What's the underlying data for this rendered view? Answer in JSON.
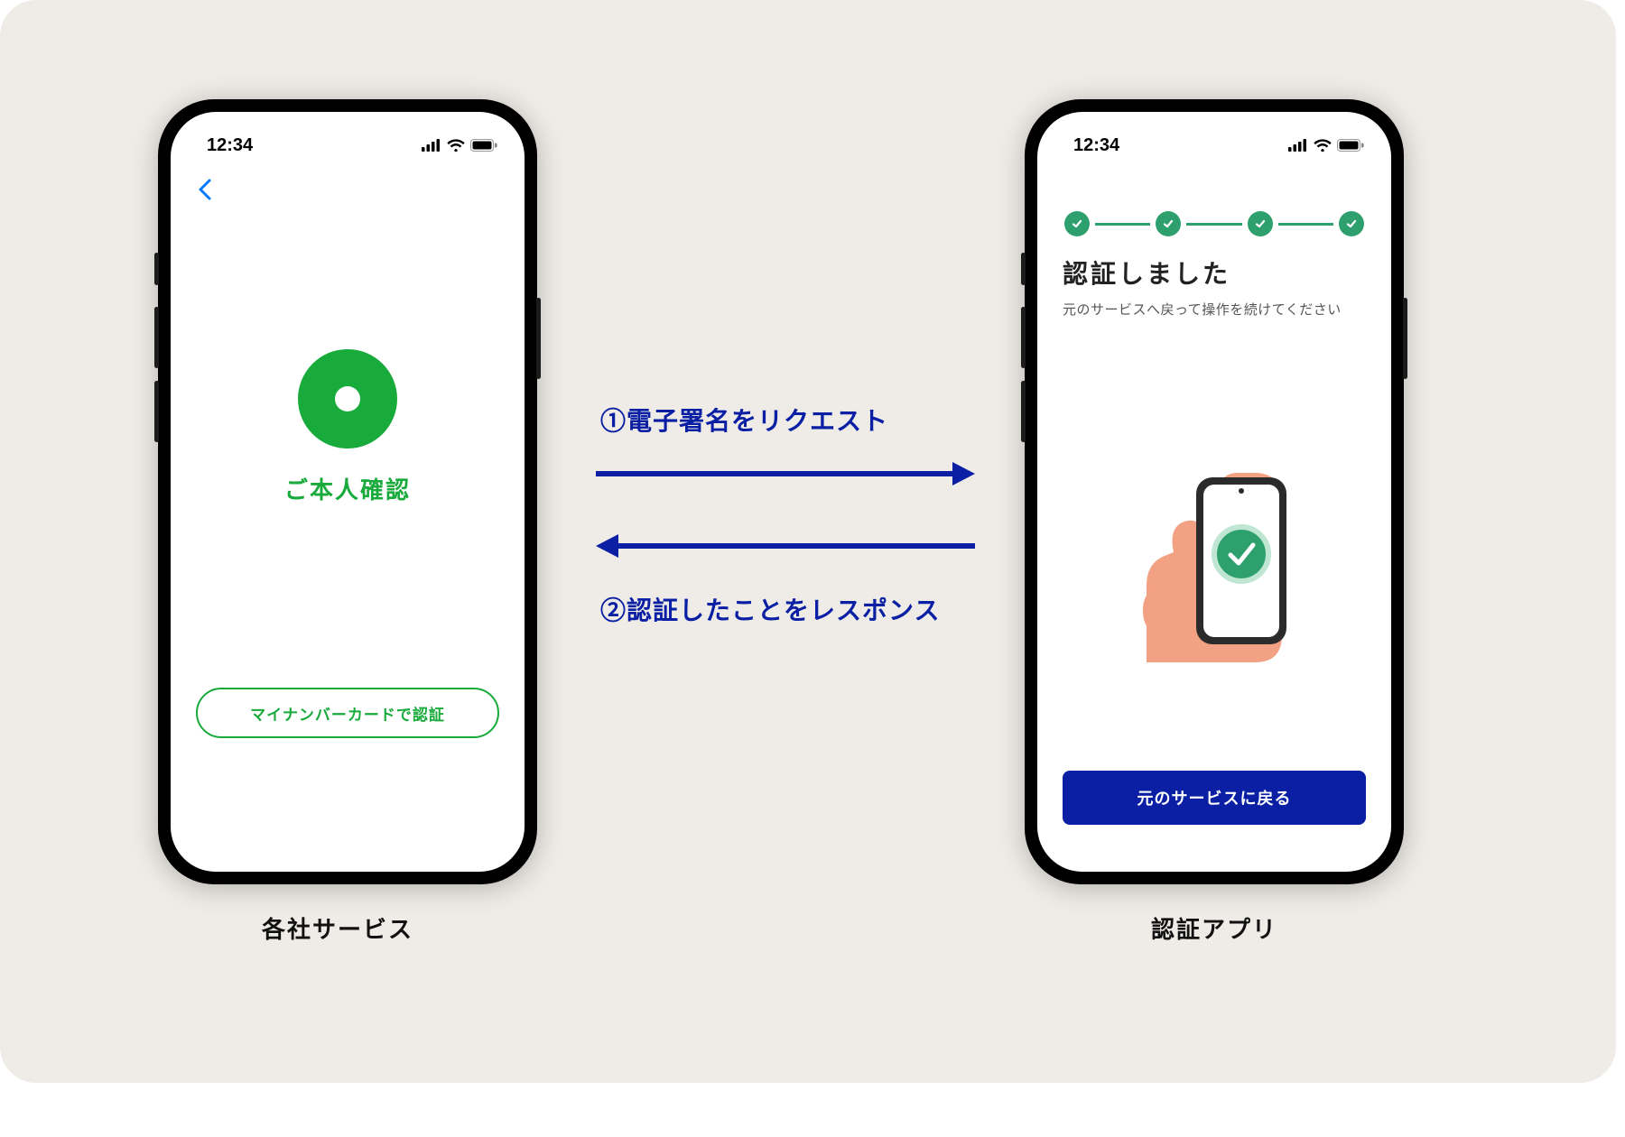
{
  "colors": {
    "panel_bg": "#EFECE7",
    "accent_green": "#18AA3B",
    "stepper_green": "#2EA06E",
    "primary_blue": "#0A1FA3",
    "ios_blue": "#0079FF"
  },
  "status_bar": {
    "time": "12:34"
  },
  "left_phone": {
    "caption": "各社サービス",
    "title": "ご本人確認",
    "button_label": "マイナンバーカードで認証"
  },
  "right_phone": {
    "caption": "認証アプリ",
    "heading": "認証しました",
    "subtext": "元のサービスへ戻って操作を続けてください",
    "button_label": "元のサービスに戻る",
    "steps_total": 4,
    "steps_done": 4
  },
  "flow": {
    "request_label": "①電子署名をリクエスト",
    "response_label": "②認証したことをレスポンス"
  }
}
